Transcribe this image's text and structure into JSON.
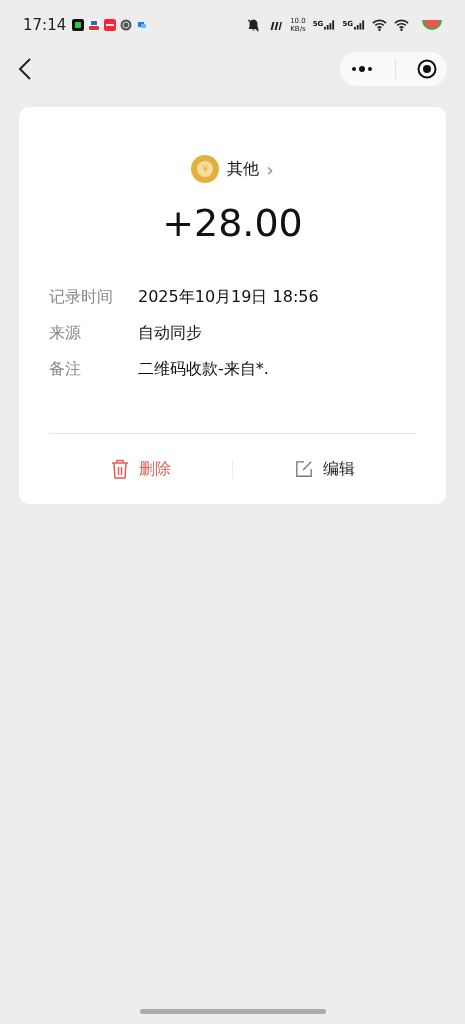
{
  "status_bar": {
    "time": "17:14",
    "speed_value": "10.0",
    "speed_unit": "KB/s",
    "signals": [
      "5G",
      "5G"
    ]
  },
  "category": {
    "symbol": "¥",
    "name": "其他",
    "chevron": "›"
  },
  "amount": "+28.00",
  "details": [
    {
      "label": "记录时间",
      "value": "2025年10月19日 18:56"
    },
    {
      "label": "来源",
      "value": "自动同步"
    },
    {
      "label": "备注",
      "value": "二维码收款-来自*."
    }
  ],
  "actions": [
    {
      "kind": "delete",
      "label": "删除"
    },
    {
      "kind": "edit",
      "label": "编辑"
    }
  ]
}
